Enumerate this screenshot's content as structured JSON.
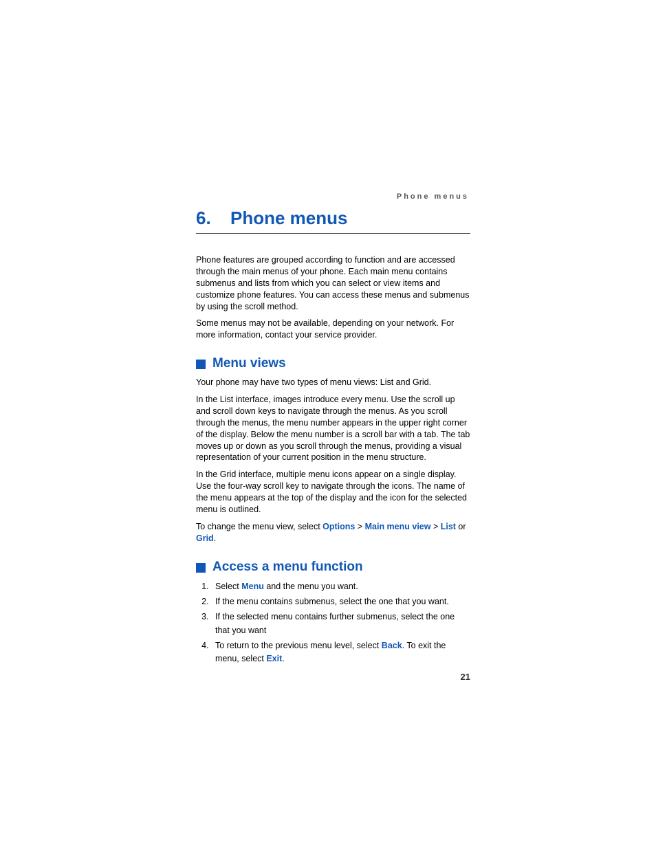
{
  "running_header": "Phone menus",
  "chapter": {
    "number": "6.",
    "title": "Phone menus"
  },
  "intro": {
    "p1": "Phone features are grouped according to function and are accessed through the main menus of your phone. Each main menu contains submenus and lists from which you can select or view items and customize phone features. You can access these menus and submenus by using the scroll method.",
    "p2": "Some menus may not be available, depending on your network. For more information, contact your service provider."
  },
  "section1": {
    "title": "Menu views",
    "p1": "Your phone may have two types of menu views: List and Grid.",
    "p2": "In the List interface, images introduce every menu. Use the scroll up and scroll down keys to navigate through the menus. As you scroll through the menus, the menu number appears in the upper right corner of the display. Below the menu number is a scroll bar with a tab. The tab moves up or down as you scroll through the menus, providing a visual representation of your current position in the menu structure.",
    "p3": "In the Grid interface, multiple menu icons appear on a single display. Use the four-way scroll key to navigate through the icons. The name of the menu appears at the top of the display and the icon for the selected menu is outlined.",
    "p4_prefix": "To change the menu view, select ",
    "kw_options": "Options",
    "sep": " > ",
    "kw_mainmenuview": "Main menu view",
    "kw_list": "List",
    "or": " or ",
    "kw_grid": "Grid",
    "period": "."
  },
  "section2": {
    "title": "Access a menu function",
    "li1_prefix": "Select ",
    "kw_menu": "Menu",
    "li1_suffix": " and the menu you want.",
    "li2": "If the menu contains submenus, select the one that you want.",
    "li3": "If the selected menu contains further submenus, select the one that you want",
    "li4_prefix": "To return to the previous menu level, select ",
    "kw_back": "Back",
    "li4_mid": ". To exit the menu, select ",
    "kw_exit": "Exit",
    "li4_suffix": "."
  },
  "page_number": "21"
}
